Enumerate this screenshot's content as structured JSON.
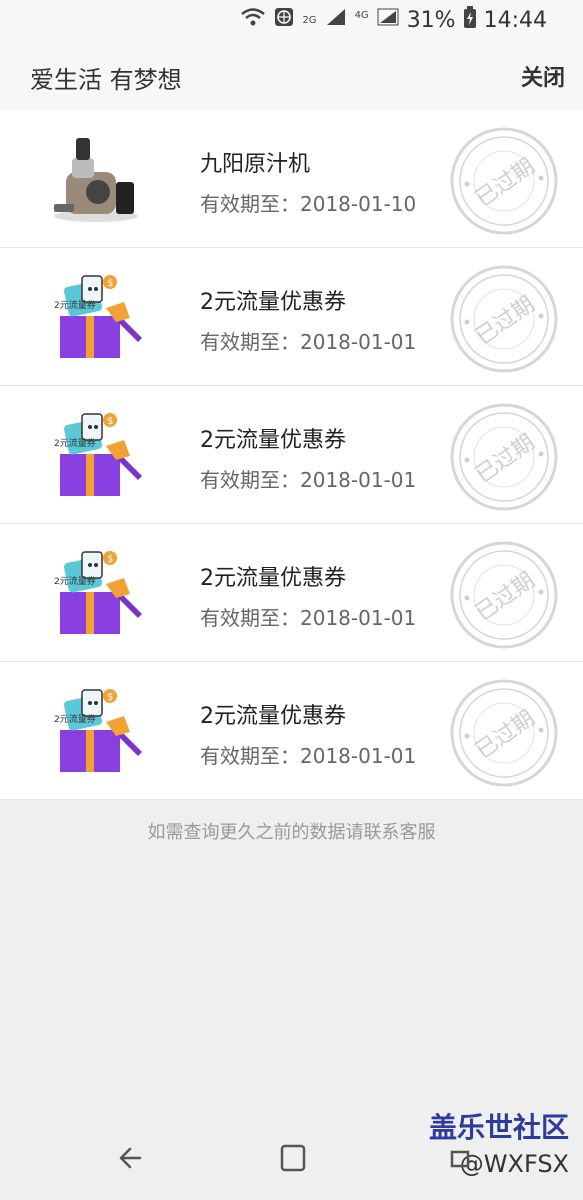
{
  "status_bar": {
    "battery": "31%",
    "time": "14:44",
    "network": "4G",
    "network_2g": "2G",
    "icons": [
      "wifi-icon",
      "globe-icon",
      "signal-icon",
      "signal-icon",
      "battery-icon"
    ]
  },
  "header": {
    "title": "爱生活 有梦想",
    "close_label": "关闭"
  },
  "items": [
    {
      "title": "九阳原汁机",
      "date": "有效期至：2018-01-10",
      "stamp": "已过期",
      "thumb": "juicer"
    },
    {
      "title": "2元流量优惠券",
      "date": "有效期至：2018-01-01",
      "stamp": "已过期",
      "thumb": "gift"
    },
    {
      "title": "2元流量优惠券",
      "date": "有效期至：2018-01-01",
      "stamp": "已过期",
      "thumb": "gift"
    },
    {
      "title": "2元流量优惠券",
      "date": "有效期至：2018-01-01",
      "stamp": "已过期",
      "thumb": "gift"
    },
    {
      "title": "2元流量优惠券",
      "date": "有效期至：2018-01-01",
      "stamp": "已过期",
      "thumb": "gift"
    }
  ],
  "gift_label": "2元流量券",
  "footer_note": "如需查询更久之前的数据请联系客服",
  "watermark": {
    "line1": "盖乐世社区",
    "line2": "@WXFSX"
  },
  "colors": {
    "accent_purple": "#8a3fe0",
    "gift_ribbon": "#f2a135",
    "stamp_gray": "#d6d6d6"
  }
}
